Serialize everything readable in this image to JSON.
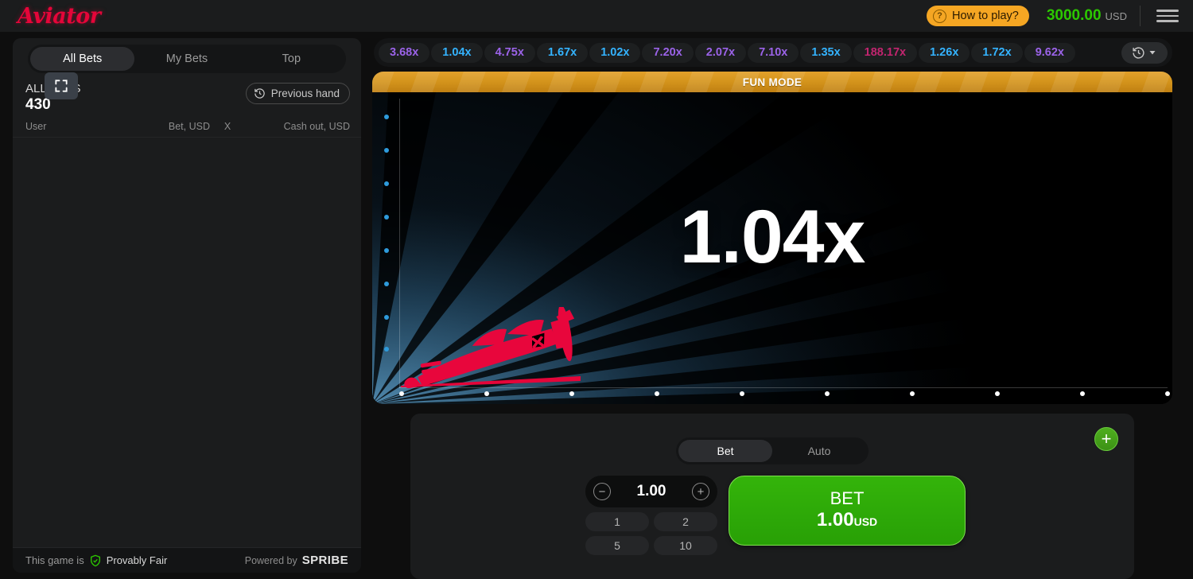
{
  "brand": {
    "logo": "Aviator"
  },
  "header": {
    "how_to_play": "How to play?",
    "help_icon": "?",
    "balance_amount": "3000.00",
    "balance_currency": "USD",
    "menu_icon": "hamburger-menu-icon"
  },
  "sidebar": {
    "fullscreen_icon": "fullscreen-icon",
    "tabs": [
      {
        "label": "All Bets",
        "active": true
      },
      {
        "label": "My Bets",
        "active": false
      },
      {
        "label": "Top",
        "active": false
      }
    ],
    "all_bets_label": "ALL BETS",
    "all_bets_count": "430",
    "previous_hand": "Previous hand",
    "history_icon": "clock-history-icon",
    "columns": [
      "User",
      "Bet, USD",
      "X",
      "Cash out, USD"
    ],
    "rows": [],
    "footer": {
      "provably_prefix": "This game is",
      "provably_label": "Provably Fair",
      "shield_icon": "shield-check-icon",
      "powered_prefix": "Powered by",
      "powered_brand": "SPRIBE"
    }
  },
  "history_bar": {
    "toggle_icon": "clock-history-icon",
    "chevron_icon": "chevron-down-icon",
    "entries": [
      {
        "value": "3.68x",
        "color": "#9b63e8"
      },
      {
        "value": "1.04x",
        "color": "#34b3ff"
      },
      {
        "value": "4.75x",
        "color": "#9b63e8"
      },
      {
        "value": "1.67x",
        "color": "#34b3ff"
      },
      {
        "value": "1.02x",
        "color": "#34b3ff"
      },
      {
        "value": "7.20x",
        "color": "#9b63e8"
      },
      {
        "value": "2.07x",
        "color": "#9b63e8"
      },
      {
        "value": "7.10x",
        "color": "#9b63e8"
      },
      {
        "value": "1.35x",
        "color": "#34b3ff"
      },
      {
        "value": "188.17x",
        "color": "#c2256f"
      },
      {
        "value": "1.26x",
        "color": "#34b3ff"
      },
      {
        "value": "1.72x",
        "color": "#34b3ff"
      },
      {
        "value": "9.62x",
        "color": "#9b63e8"
      }
    ]
  },
  "game": {
    "mode_banner": "FUN MODE",
    "current_multiplier": "1.04x",
    "plane_icon": "airplane-icon",
    "accent_color": "#e50539"
  },
  "bet_panel": {
    "tabs": [
      {
        "label": "Bet",
        "active": true
      },
      {
        "label": "Auto",
        "active": false
      }
    ],
    "add_panel_icon": "plus-icon",
    "add_panel_label": "+",
    "decrement_icon": "minus-circle-icon",
    "decrement_label": "−",
    "increment_icon": "plus-circle-icon",
    "increment_label": "+",
    "stake_value": "1.00",
    "quick_amounts": [
      "1",
      "2",
      "5",
      "10"
    ],
    "bet_button": {
      "title": "BET",
      "amount": "1.00",
      "currency": "USD"
    }
  }
}
